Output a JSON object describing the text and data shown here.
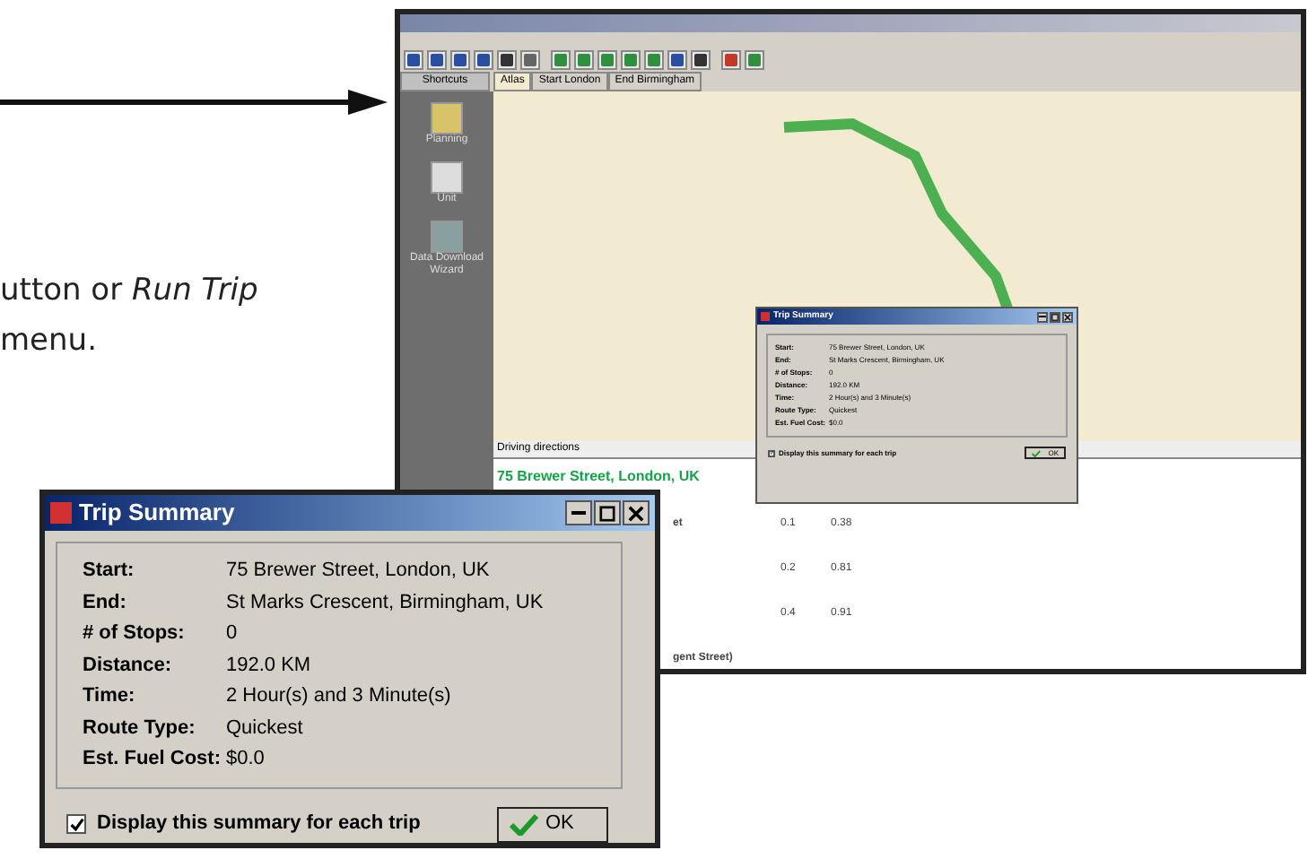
{
  "caption": {
    "lines": [
      "utton or *Run Trip*",
      "menu."
    ]
  },
  "main_window": {
    "tabs": [
      {
        "label": "Atlas",
        "selected": true
      },
      {
        "label": "Start London",
        "selected": false
      },
      {
        "label": "End Birmingham",
        "selected": false
      }
    ],
    "sidebar": {
      "header": "Shortcuts",
      "items": [
        {
          "label": "Planning"
        },
        {
          "label": "Unit"
        },
        {
          "label": "Data Download Wizard"
        }
      ]
    },
    "directions": {
      "header": "Driving directions",
      "start": "75 Brewer Street, London, UK",
      "rows": [
        {
          "text": "et",
          "column_2": "0.1",
          "column_3": "0.38"
        },
        {
          "text": "",
          "column_2": "0.2",
          "column_3": "0.81"
        },
        {
          "text": "",
          "column_2": "0.4",
          "column_3": "0.91"
        },
        {
          "text": "gent Street)",
          "column_2": "",
          "column_3": ""
        }
      ]
    },
    "small_dialog": {
      "title": "Trip Summary",
      "fields": [
        {
          "label": "Start:",
          "value": "75 Brewer Street, London, UK"
        },
        {
          "label": "End:",
          "value": "St Marks Crescent, Birmingham, UK"
        },
        {
          "label": "# of Stops:",
          "value": "0"
        },
        {
          "label": "Distance:",
          "value": "192.0 KM"
        },
        {
          "label": "Time:",
          "value": "2 Hour(s) and 3 Minute(s)"
        },
        {
          "label": "Route Type:",
          "value": "Quickest"
        },
        {
          "label": "Est. Fuel Cost:",
          "value": "$0.0"
        }
      ],
      "checkbox": {
        "label": "Display this summary for each trip",
        "checked": true
      },
      "ok": "OK"
    }
  },
  "dialog": {
    "title": "Trip Summary",
    "fields": [
      {
        "label": "Start:",
        "value": "75 Brewer Street, London, UK"
      },
      {
        "label": "End:",
        "value": "St Marks Crescent, Birmingham, UK"
      },
      {
        "label": "# of Stops:",
        "value": "0"
      },
      {
        "label": "Distance:",
        "value": "192.0 KM"
      },
      {
        "label": "Time:",
        "value": "2 Hour(s) and 3 Minute(s)"
      },
      {
        "label": "Route Type:",
        "value": "Quickest"
      },
      {
        "label": "Est. Fuel Cost:",
        "value": "$0.0"
      }
    ],
    "checkbox": {
      "label": "Display this summary for each trip",
      "checked": true
    },
    "ok": "OK"
  }
}
